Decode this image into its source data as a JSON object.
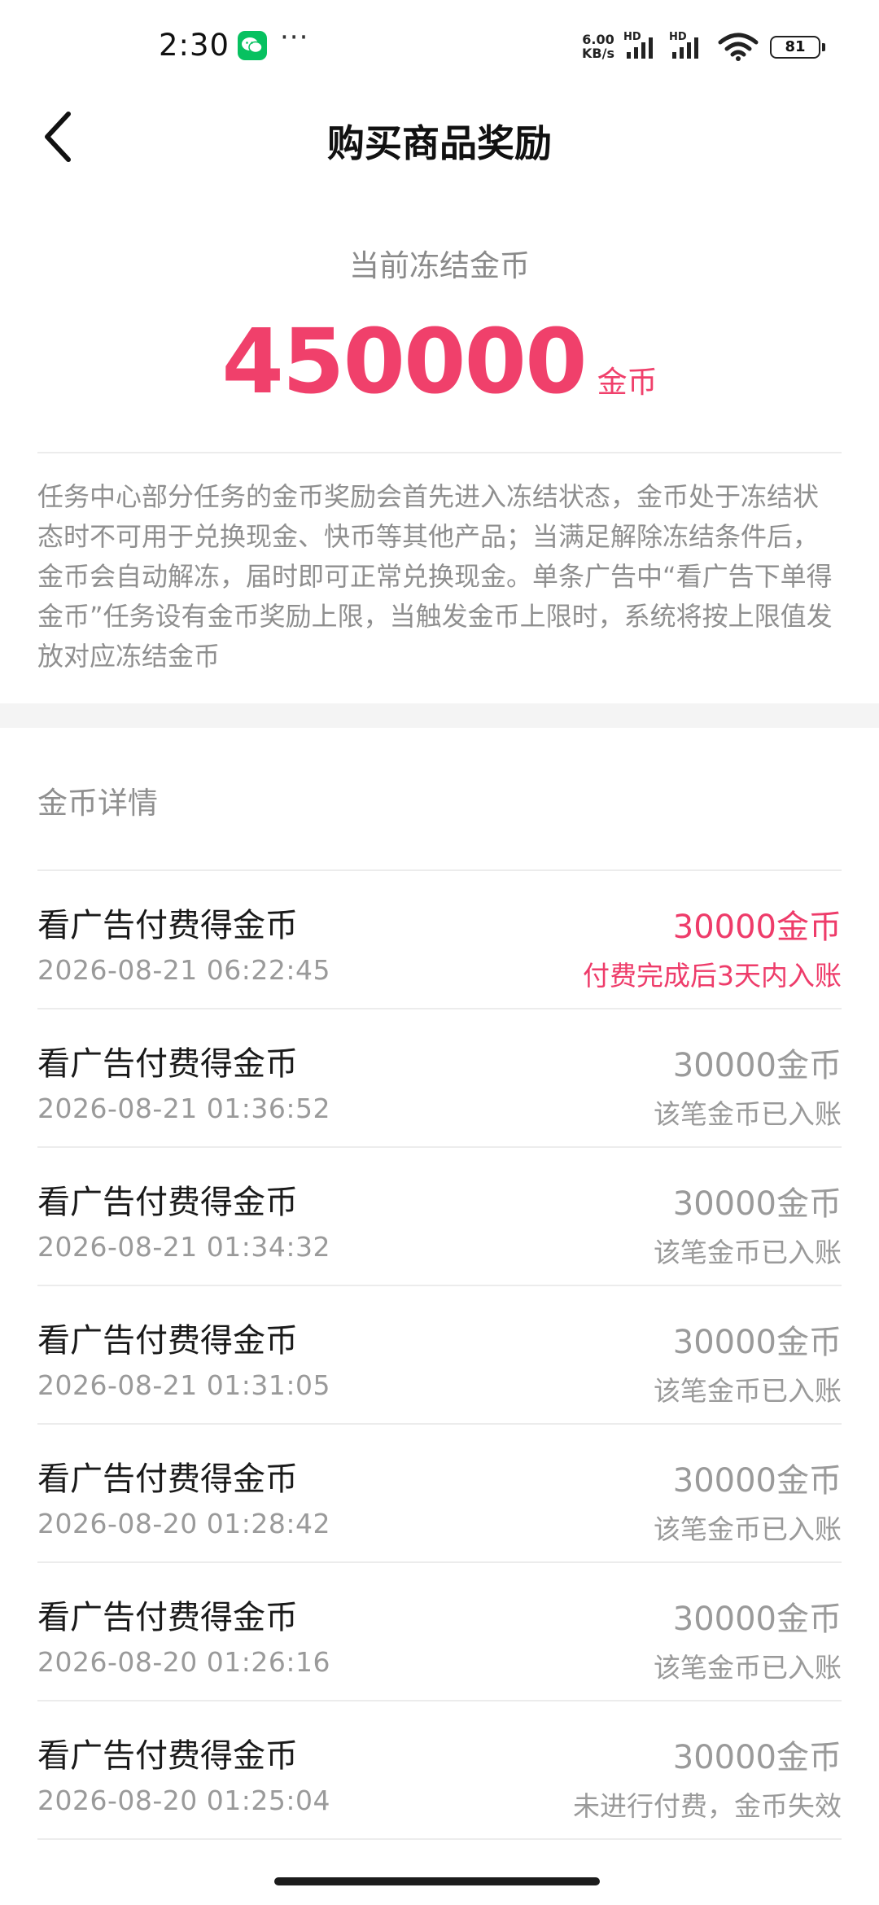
{
  "status_bar": {
    "time": "2:30",
    "dots": "···",
    "net_speed_value": "6.00",
    "net_speed_unit": "KB/s",
    "hd_label": "HD",
    "battery": "81"
  },
  "header": {
    "title": "购买商品奖励"
  },
  "summary": {
    "label": "当前冻结金币",
    "amount": "450000",
    "unit": "金币",
    "description": "任务中心部分任务的金币奖励会首先进入冻结状态，金币处于冻结状态时不可用于兑换现金、快币等其他产品；当满足解除冻结条件后，金币会自动解冻，届时即可正常兑换现金。单条广告中“看广告下单得金币”任务设有金币奖励上限，当触发金币上限时，系统将按上限值发放对应冻结金币"
  },
  "details": {
    "title": "金币详情",
    "rows": [
      {
        "title": "看广告付费得金币",
        "time": "2026-08-21 06:22:45",
        "amount": "30000金币",
        "status": "付费完成后3天内入账"
      },
      {
        "title": "看广告付费得金币",
        "time": "2026-08-21 01:36:52",
        "amount": "30000金币",
        "status": "该笔金币已入账"
      },
      {
        "title": "看广告付费得金币",
        "time": "2026-08-21 01:34:32",
        "amount": "30000金币",
        "status": "该笔金币已入账"
      },
      {
        "title": "看广告付费得金币",
        "time": "2026-08-21 01:31:05",
        "amount": "30000金币",
        "status": "该笔金币已入账"
      },
      {
        "title": "看广告付费得金币",
        "time": "2026-08-20 01:28:42",
        "amount": "30000金币",
        "status": "该笔金币已入账"
      },
      {
        "title": "看广告付费得金币",
        "time": "2026-08-20 01:26:16",
        "amount": "30000金币",
        "status": "该笔金币已入账"
      },
      {
        "title": "看广告付费得金币",
        "time": "2026-08-20 01:25:04",
        "amount": "30000金币",
        "status": "未进行付费，金币失效"
      }
    ]
  },
  "colors": {
    "accent": "#f0406b",
    "pending": "#ee3c6a",
    "muted_text": "#9a9a9a",
    "wechat": "#07c160"
  },
  "icons": {
    "back": "chevron-left-icon",
    "wechat": "wechat-icon",
    "signal": "signal-icon",
    "wifi": "wifi-icon",
    "battery": "battery-icon"
  }
}
